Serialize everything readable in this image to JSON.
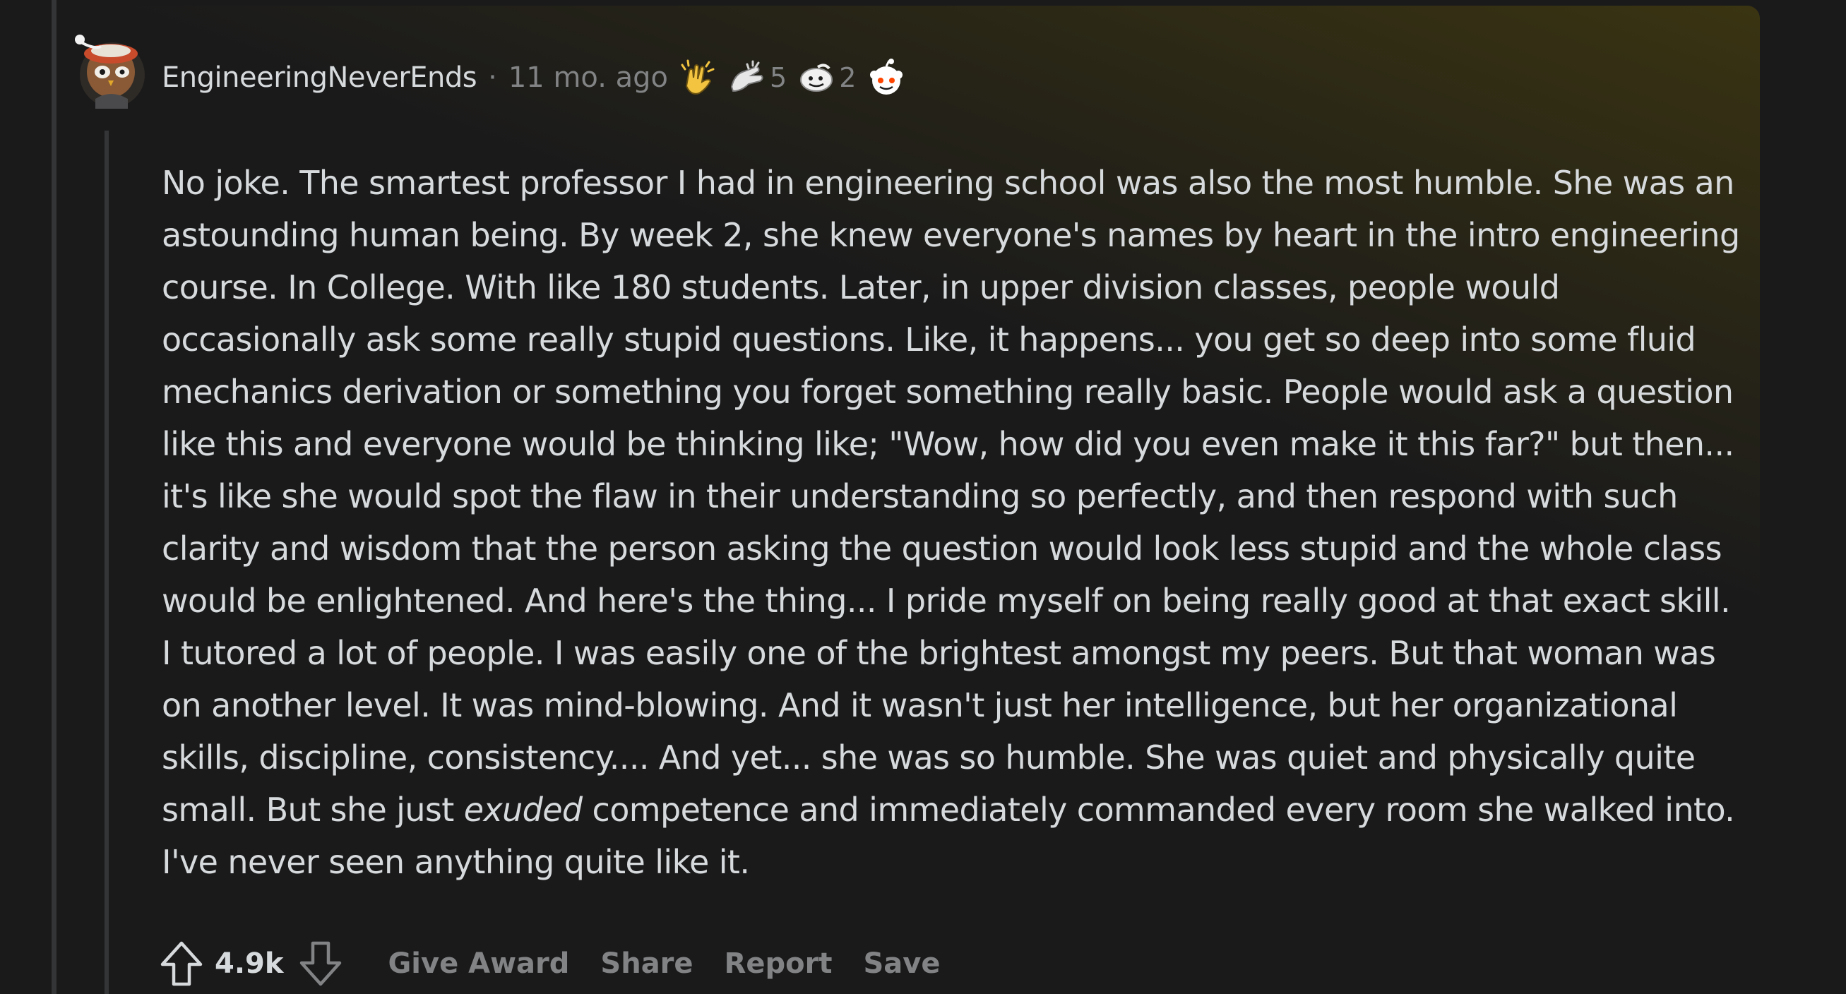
{
  "comment": {
    "author": "EngineeringNeverEnds",
    "separator": "·",
    "age": "11 mo. ago",
    "awards": [
      {
        "icon": "clapping-hands-icon",
        "count": ""
      },
      {
        "icon": "hand-award-icon",
        "count": "5"
      },
      {
        "icon": "face-award-icon",
        "count": "2"
      },
      {
        "icon": "snoo-award-icon",
        "count": ""
      }
    ],
    "body": {
      "before_em": "No joke. The smartest professor I had in engineering school was also the most humble. She was an astounding human being. By week 2, she knew everyone's names by heart in the intro engineering course. In College. With like 180 students. Later, in upper division classes, people would occasionally ask some really stupid questions. Like, it happens... you get so deep into some fluid mechanics derivation or something you forget something really basic. People would ask a question like this and everyone would be thinking like; \"Wow, how did you even make it this far?\" but then... it's like she would spot the flaw in their understanding so perfectly, and then respond with such clarity and wisdom that the person asking the question would look less stupid and the whole class would be enlightened. And here's the thing... I pride myself on being really good at that exact skill. I tutored a lot of people. I was easily one of the brightest amongst my peers. But that woman was on another level. It was mind-blowing. And it wasn't just her intelligence, but her organizational skills, discipline, consistency.... And yet... she was so humble. She was quiet and physically quite small. But she just ",
      "em": "exuded",
      "after_em": " competence and immediately commanded every room she walked into. I've never seen anything quite like it."
    },
    "actions": {
      "score": "4.9k",
      "give_award": "Give Award",
      "share": "Share",
      "report": "Report",
      "save": "Save"
    }
  },
  "colors": {
    "background": "#1a1a1b",
    "text": "#d7dadc",
    "muted": "#818384",
    "thread_line": "#343536"
  }
}
